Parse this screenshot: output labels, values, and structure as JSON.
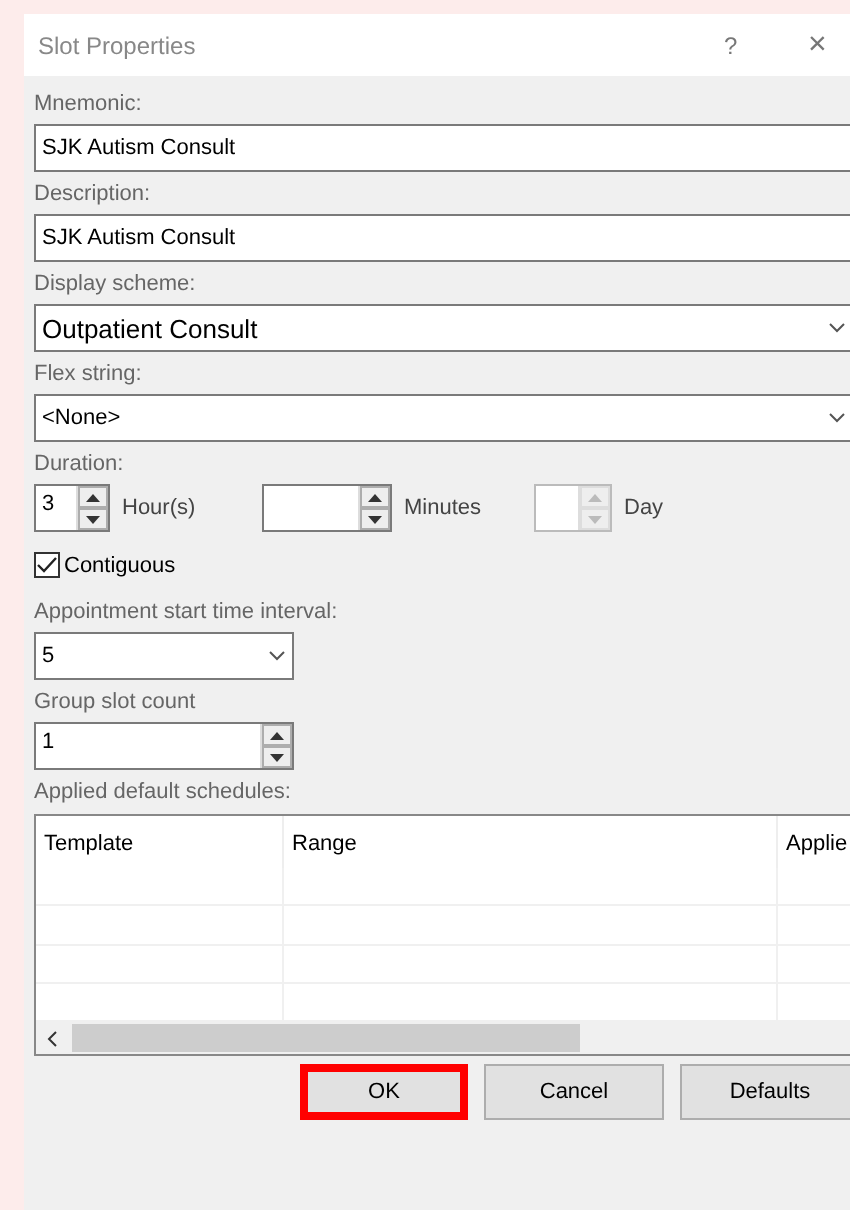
{
  "window": {
    "title": "Slot Properties",
    "help": "?",
    "close": "×"
  },
  "fields": [
    {
      "label": "Mnemonic:",
      "kind": "text",
      "value": "SJK Autism Consult"
    },
    {
      "label": "Description:",
      "kind": "text",
      "value": "SJK Autism Consult"
    },
    {
      "label": "Display scheme:",
      "kind": "dropdown",
      "value": "Outpatient Consult"
    },
    {
      "label": "Flex string:",
      "kind": "dropdown",
      "value": "<None>"
    }
  ],
  "duration": {
    "label": "Duration:",
    "parts": [
      {
        "value": "3",
        "unit": "Hour(s)",
        "disabled": false
      },
      {
        "unit": "Minutes",
        "disabled": false
      },
      {
        "unit": "Day",
        "disabled": true
      }
    ]
  },
  "contiguous": {
    "label": "Contiguous",
    "checked": true
  },
  "interval": {
    "label": "Appointment start time interval:",
    "value": "5"
  },
  "group_slot_count": {
    "label": "Group slot count",
    "value": "1"
  },
  "table": {
    "label": "Applied default schedules:",
    "columns": [
      "Template",
      "Range",
      "Applie"
    ]
  },
  "buttons": [
    {
      "label": "OK",
      "highlighted": true
    },
    {
      "label": "Cancel",
      "highlighted": false
    },
    {
      "label": "Defaults",
      "highlighted": false
    }
  ]
}
